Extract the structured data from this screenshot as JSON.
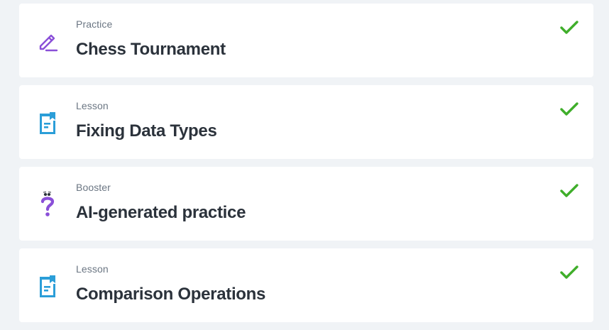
{
  "items": [
    {
      "type": "Practice",
      "title": "Chess Tournament",
      "icon": "pencil-icon",
      "completed": true
    },
    {
      "type": "Lesson",
      "title": "Fixing Data Types",
      "icon": "lesson-book-icon",
      "completed": true
    },
    {
      "type": "Booster",
      "title": "AI-generated practice",
      "icon": "question-mark-icon",
      "completed": true
    },
    {
      "type": "Lesson",
      "title": "Comparison Operations",
      "icon": "lesson-book-icon",
      "completed": true
    }
  ],
  "colors": {
    "practice_icon": "#8a4fd8",
    "lesson_icon": "#2b9ed8",
    "booster_icon": "#8a4fd8",
    "check": "#3fae2a",
    "title_text": "#2b323b",
    "type_text": "#6b7683",
    "background": "#f0f3f6",
    "card": "#ffffff"
  }
}
